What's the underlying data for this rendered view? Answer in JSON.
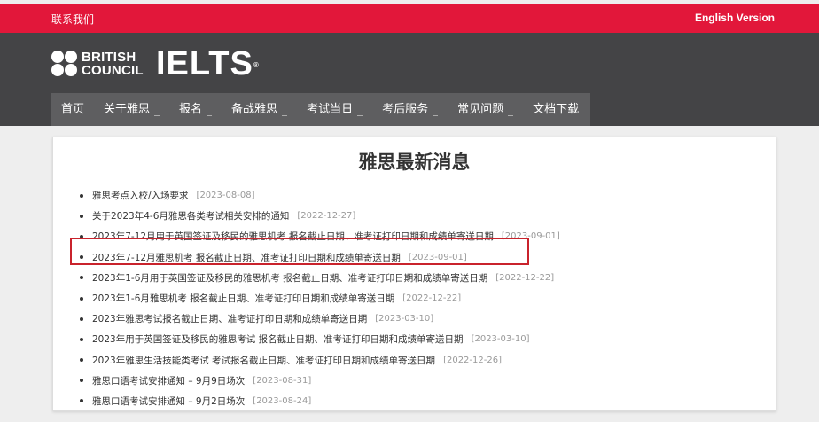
{
  "topbar": {
    "contact": "联系我们",
    "english": "English Version"
  },
  "brand": {
    "org_line1": "BRITISH",
    "org_line2": "COUNCIL",
    "product": "IELTS"
  },
  "nav": [
    {
      "label": "首页",
      "dropdown": false
    },
    {
      "label": "关于雅思",
      "dropdown": true
    },
    {
      "label": "报名",
      "dropdown": true
    },
    {
      "label": "备战雅思",
      "dropdown": true
    },
    {
      "label": "考试当日",
      "dropdown": true
    },
    {
      "label": "考后服务",
      "dropdown": true
    },
    {
      "label": "常见问题",
      "dropdown": true
    },
    {
      "label": "文档下载",
      "dropdown": false
    }
  ],
  "main": {
    "title": "雅思最新消息",
    "news": [
      {
        "title": "雅思考点入校/入场要求",
        "date": "[2023-08-08]"
      },
      {
        "title": "关于2023年4-6月雅思各类考试相关安排的通知",
        "date": "[2022-12-27]"
      },
      {
        "title": "2023年7-12月用于英国签证及移民的雅思机考 报名截止日期、准考证打印日期和成绩单寄送日期",
        "date": "[2023-09-01]"
      },
      {
        "title": "2023年7-12月雅思机考 报名截止日期、准考证打印日期和成绩单寄送日期",
        "date": "[2023-09-01]"
      },
      {
        "title": "2023年1-6月用于英国签证及移民的雅思机考 报名截止日期、准考证打印日期和成绩单寄送日期",
        "date": "[2022-12-22]"
      },
      {
        "title": "2023年1-6月雅思机考 报名截止日期、准考证打印日期和成绩单寄送日期",
        "date": "[2022-12-22]"
      },
      {
        "title": "2023年雅思考试报名截止日期、准考证打印日期和成绩单寄送日期",
        "date": "[2023-03-10]"
      },
      {
        "title": "2023年用于英国签证及移民的雅思考试 报名截止日期、准考证打印日期和成绩单寄送日期",
        "date": "[2023-03-10]"
      },
      {
        "title": "2023年雅思生活技能类考试 考试报名截止日期、准考证打印日期和成绩单寄送日期",
        "date": "[2022-12-26]"
      },
      {
        "title": "雅思口语考试安排通知 – 9月9日场次",
        "date": "[2023-08-31]"
      },
      {
        "title": "雅思口语考试安排通知 – 9月2日场次",
        "date": "[2023-08-24]"
      }
    ]
  }
}
